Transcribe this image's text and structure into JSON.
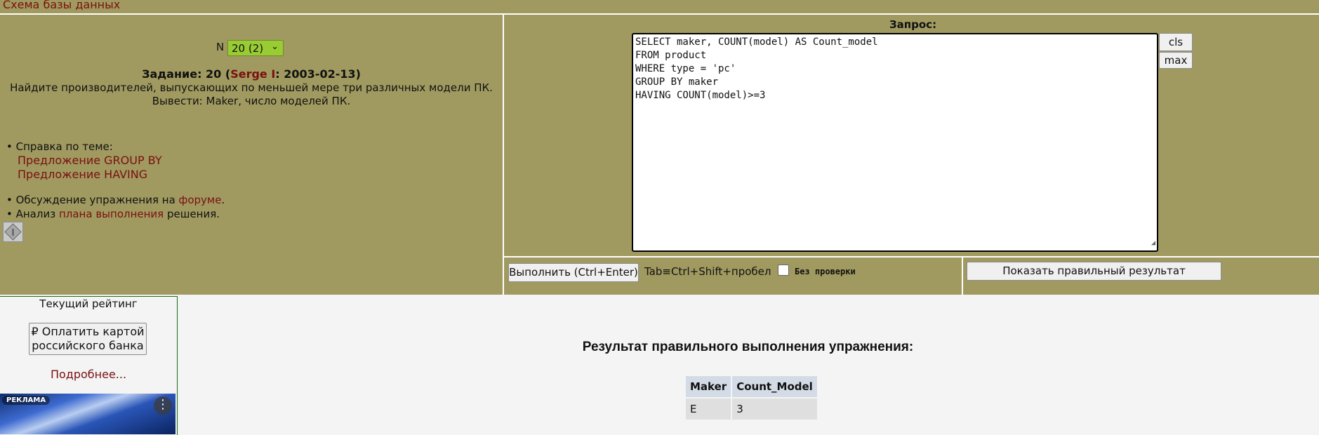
{
  "header": {
    "schema_link": "Схема базы данных"
  },
  "task": {
    "n_label": "N",
    "n_selected": "20 (2)",
    "title_prefix": "Задание: 20 (",
    "author": "Serge I",
    "title_suffix": ": 2003-02-13)",
    "text_line1": "Найдите производителей, выпускающих по меньшей мере три различных модели ПК.",
    "text_line2": "Вывести: Maker, число моделей ПК."
  },
  "help": {
    "label": "• Справка по теме:",
    "links": [
      "Предложение GROUP BY",
      "Предложение HAVING"
    ],
    "forum_prefix": "• Обсуждение упражнения на ",
    "forum_link": "форуме",
    "forum_suffix": ".",
    "plan_prefix": "• Анализ ",
    "plan_link": "плана выполнения",
    "plan_suffix": " решения."
  },
  "query": {
    "label": "Запрос:",
    "text": "SELECT maker, COUNT(model) AS Count_model\nFROM product\nWHERE type = 'pc'\nGROUP BY maker\nHAVING COUNT(model)>=3",
    "cls_label": "cls",
    "max_label": "max"
  },
  "controls": {
    "run_label": "Выполнить (Ctrl+Enter)",
    "tab_hint": "Tab≡Ctrl+Shift+пробел",
    "no_check_label": "Без проверки",
    "show_result_label": "Показать правильный результат"
  },
  "rating": {
    "title": "Текущий рейтинг",
    "pay_line1": "₽ Оплатить картой",
    "pay_line2": "российского банка",
    "more_link": "Подробнее..."
  },
  "ad": {
    "tag": "РЕКЛАМА",
    "menu": "⋮"
  },
  "result": {
    "title": "Результат правильного выполнения упражнения:",
    "columns": [
      "Maker",
      "Count_Model"
    ],
    "rows": [
      [
        "E",
        "3"
      ]
    ]
  }
}
